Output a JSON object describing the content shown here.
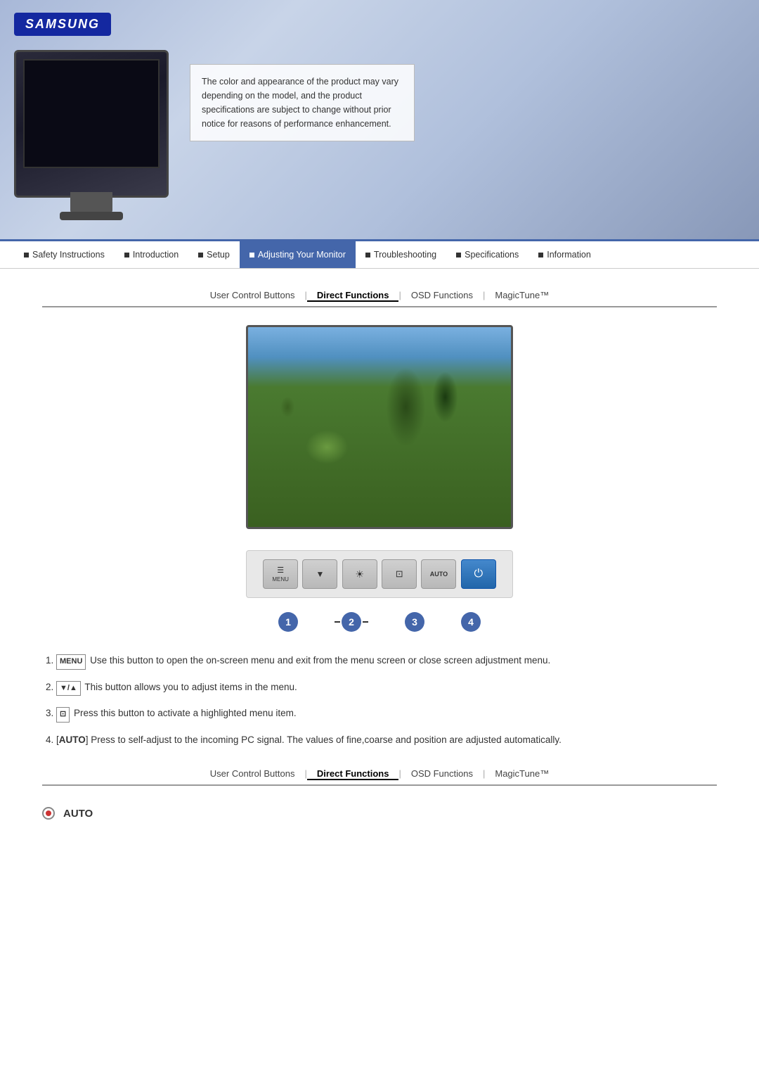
{
  "brand": "SAMSUNG",
  "header": {
    "notice_text": "The color and appearance of the product may vary depending on the model, and the product specifications are subject to change without prior notice for reasons of performance enhancement."
  },
  "nav": {
    "items": [
      {
        "label": "Safety Instructions",
        "active": false
      },
      {
        "label": "Introduction",
        "active": false
      },
      {
        "label": "Setup",
        "active": false
      },
      {
        "label": "Adjusting Your Monitor",
        "active": true
      },
      {
        "label": "Troubleshooting",
        "active": false
      },
      {
        "label": "Specifications",
        "active": false
      },
      {
        "label": "Information",
        "active": false
      }
    ]
  },
  "sub_nav": {
    "items": [
      {
        "label": "User Control Buttons",
        "active": false
      },
      {
        "label": "Direct Functions",
        "active": true
      },
      {
        "label": "OSD Functions",
        "active": false
      },
      {
        "label": "MagicTune™",
        "active": false
      }
    ],
    "separator": "|"
  },
  "sub_nav_bottom": {
    "items": [
      {
        "label": "User Control Buttons",
        "active": false
      },
      {
        "label": "Direct Functions",
        "active": true
      },
      {
        "label": "OSD Functions",
        "active": false
      },
      {
        "label": "MagicTune™",
        "active": false
      }
    ]
  },
  "control_buttons": [
    {
      "id": "1",
      "top_label": "MENU",
      "symbol": "☰"
    },
    {
      "id": "2a",
      "top_label": "▼",
      "symbol": "▼"
    },
    {
      "id": "2b",
      "top_label": "▲",
      "symbol": "▲"
    },
    {
      "id": "3",
      "top_label": "☑",
      "symbol": "⊡"
    },
    {
      "id": "4",
      "top_label": "AUTO",
      "symbol": "AUTO"
    },
    {
      "id": "power",
      "top_label": "⏻",
      "symbol": "⏻"
    }
  ],
  "number_labels": [
    "1",
    "2",
    "3",
    "4"
  ],
  "instructions": [
    {
      "num": "1",
      "icon": "MENU",
      "text": "Use this button to open the on-screen menu and exit from the menu screen or close screen adjustment menu."
    },
    {
      "num": "2",
      "icon": "▼/▲",
      "text": "This button allows you to adjust items in the menu."
    },
    {
      "num": "3",
      "icon": "⊡",
      "text": "Press this button to activate a highlighted menu item."
    },
    {
      "num": "4",
      "icon": "AUTO",
      "text": "Press to self-adjust to the incoming PC signal. The values of fine,coarse and position are adjusted automatically."
    }
  ],
  "auto_section": {
    "label": "AUTO"
  }
}
